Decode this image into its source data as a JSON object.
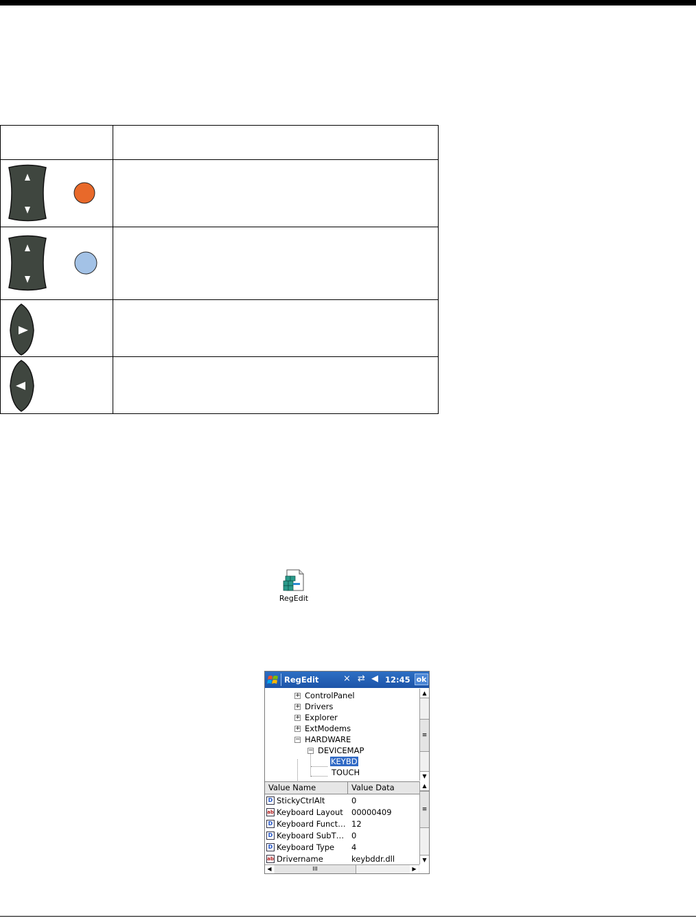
{
  "key_table": {
    "header": {
      "col1": "",
      "col2": ""
    },
    "rows": [
      {
        "key_icon": "up-down-key-icon",
        "dot_icon": "orange-circle-key-icon",
        "dot_color": "#e8692a",
        "description": ""
      },
      {
        "key_icon": "up-down-key-icon",
        "dot_icon": "blue-circle-key-icon",
        "dot_color": "#a3c2e6",
        "description": ""
      },
      {
        "key_icon": "right-arrow-key-icon",
        "description": ""
      },
      {
        "key_icon": "left-arrow-key-icon",
        "description": ""
      }
    ]
  },
  "desktop_icon": {
    "label": "RegEdit",
    "icon": "regedit-icon"
  },
  "regedit": {
    "title": "RegEdit",
    "status_icons": [
      "signal-off-icon",
      "sync-icon",
      "speaker-muted-icon"
    ],
    "time": "12:45",
    "ok_label": "ok",
    "tree": [
      {
        "label": "ControlPanel",
        "expander": "+",
        "selected": false
      },
      {
        "label": "Drivers",
        "expander": "+",
        "selected": false
      },
      {
        "label": "Explorer",
        "expander": "+",
        "selected": false
      },
      {
        "label": "ExtModems",
        "expander": "+",
        "selected": false
      },
      {
        "label": "HARDWARE",
        "expander": "−",
        "selected": false
      },
      {
        "label": "DEVICEMAP",
        "expander": "−",
        "selected": false
      },
      {
        "label": "KEYBD",
        "expander": "",
        "selected": true
      },
      {
        "label": "TOUCH",
        "expander": "",
        "selected": false
      }
    ],
    "columns": {
      "name": "Value Name",
      "data": "Value Data"
    },
    "values": [
      {
        "type": "dword",
        "icon_text": "D",
        "name": "StickyCtrlAlt",
        "data": "0"
      },
      {
        "type": "string",
        "icon_text": "ab",
        "name": "Keyboard Layout",
        "data": "00000409"
      },
      {
        "type": "dword",
        "icon_text": "D",
        "name": "Keyboard Funct…",
        "data": "12"
      },
      {
        "type": "dword",
        "icon_text": "D",
        "name": "Keyboard SubT…",
        "data": "0"
      },
      {
        "type": "dword",
        "icon_text": "D",
        "name": "Keyboard Type",
        "data": "4"
      },
      {
        "type": "string",
        "icon_text": "ab",
        "name": "Drivername",
        "data": "keybddr.dll"
      }
    ],
    "colors": {
      "titlebar": "#1d54a8",
      "selection": "#316ac5"
    }
  }
}
